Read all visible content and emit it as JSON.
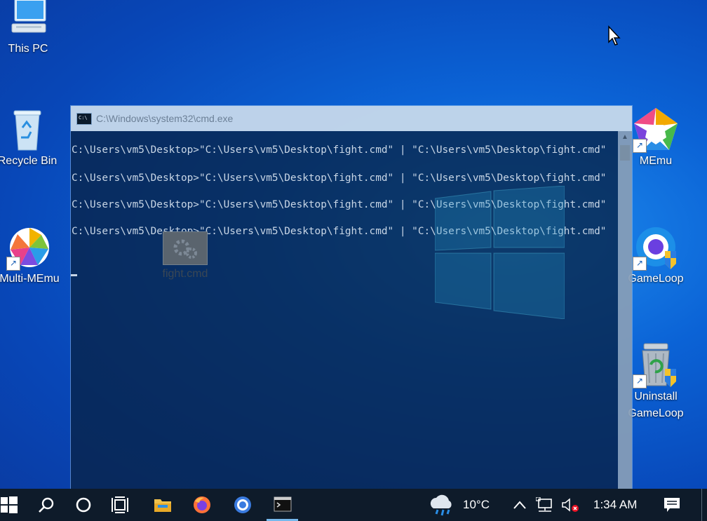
{
  "desktop": {
    "icons": {
      "this_pc": "This PC",
      "recycle_bin": "Recycle Bin",
      "multi_memu": "Multi-MEmu",
      "memu": "MEmu",
      "gameloop": "GameLoop",
      "uninstall_gameloop_1": "Uninstall",
      "uninstall_gameloop_2": "GameLoop",
      "fight_cmd": "fight.cmd"
    }
  },
  "cmd_window": {
    "title": "C:\\Windows\\system32\\cmd.exe",
    "lines": [
      "C:\\Users\\vm5\\Desktop>\"C:\\Users\\vm5\\Desktop\\fight.cmd\" | \"C:\\Users\\vm5\\Desktop\\fight.cmd\"",
      "C:\\Users\\vm5\\Desktop>\"C:\\Users\\vm5\\Desktop\\fight.cmd\" | \"C:\\Users\\vm5\\Desktop\\fight.cmd\"",
      "C:\\Users\\vm5\\Desktop>\"C:\\Users\\vm5\\Desktop\\fight.cmd\" | \"C:\\Users\\vm5\\Desktop\\fight.cmd\"",
      "C:\\Users\\vm5\\Desktop>\"C:\\Users\\vm5\\Desktop\\fight.cmd\" | \"C:\\Users\\vm5\\Desktop\\fight.cmd\""
    ]
  },
  "taskbar": {
    "weather_temp": "10°C",
    "time": "1:34 AM"
  },
  "colors": {
    "taskbar_bg": "#0e1b2a",
    "accent": "#76b9ed",
    "desktop_blue": "#0b63d6"
  }
}
